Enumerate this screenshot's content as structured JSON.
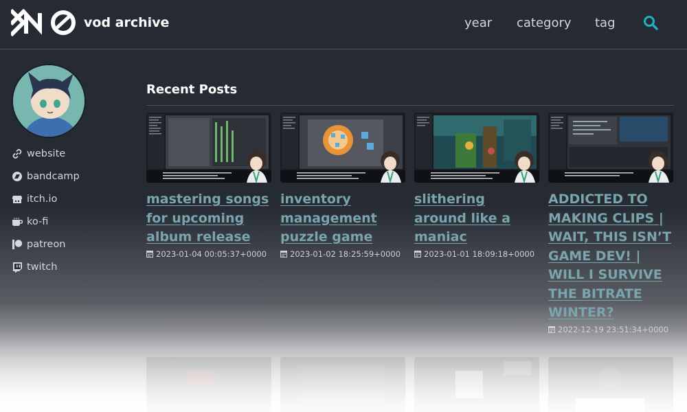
{
  "header": {
    "brand": "vod archive",
    "nav": [
      {
        "label": "year"
      },
      {
        "label": "category"
      },
      {
        "label": "tag"
      }
    ],
    "search_icon": "search-icon",
    "accent_color": "#1fb3c2"
  },
  "sidebar": {
    "links": [
      {
        "label": "website",
        "icon": "link-icon"
      },
      {
        "label": "bandcamp",
        "icon": "bandcamp-icon"
      },
      {
        "label": "itch.io",
        "icon": "itchio-icon"
      },
      {
        "label": "ko-fi",
        "icon": "coffee-cup-icon"
      },
      {
        "label": "patreon",
        "icon": "patreon-icon"
      },
      {
        "label": "twitch",
        "icon": "twitch-icon"
      }
    ]
  },
  "main": {
    "section_title": "Recent Posts",
    "posts": [
      {
        "title": "mastering songs for upcoming album release",
        "date": "2023-01-04 00:05:37+0000"
      },
      {
        "title": "inventory management puzzle game",
        "date": "2023-01-02 18:25:59+0000"
      },
      {
        "title": "slithering around like a maniac",
        "date": "2023-01-01 18:09:18+0000"
      },
      {
        "title": "ADDICTED TO MAKING CLIPS | WAIT, THIS ISN’T GAME DEV! | WILL I SURVIVE THE BITRATE WINTER?",
        "date": "2022-12-19 23:51:34+0000"
      }
    ]
  },
  "colors": {
    "background": "#262a33",
    "link": "#7ba5ad",
    "text": "#e7e9ee"
  }
}
